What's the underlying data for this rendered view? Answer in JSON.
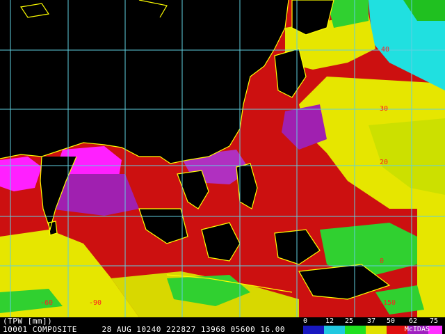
{
  "map": {
    "colors": {
      "background": "#000000",
      "grid": "#5fd0e0",
      "coast": "#ffff00",
      "label": "#ff2020",
      "land": "#000000"
    },
    "lat_labels": [
      "40",
      "30",
      "20",
      "0"
    ],
    "lon_labels": [
      "-60",
      "-90",
      "-150"
    ]
  },
  "status": {
    "line1": "(TPW [mm])",
    "line2": "10001 COMPOSITE     28 AUG 10240 222827 13968 05600 16.00"
  },
  "colorbar": {
    "labels": [
      "0",
      "12",
      "25",
      "37",
      "50",
      "62",
      "75"
    ],
    "colors": [
      "#1818c0",
      "#20c8e0",
      "#20e020",
      "#e0e000",
      "#e01010",
      "#a020c0",
      "#ff30ff"
    ],
    "brand": "McIDAS"
  }
}
